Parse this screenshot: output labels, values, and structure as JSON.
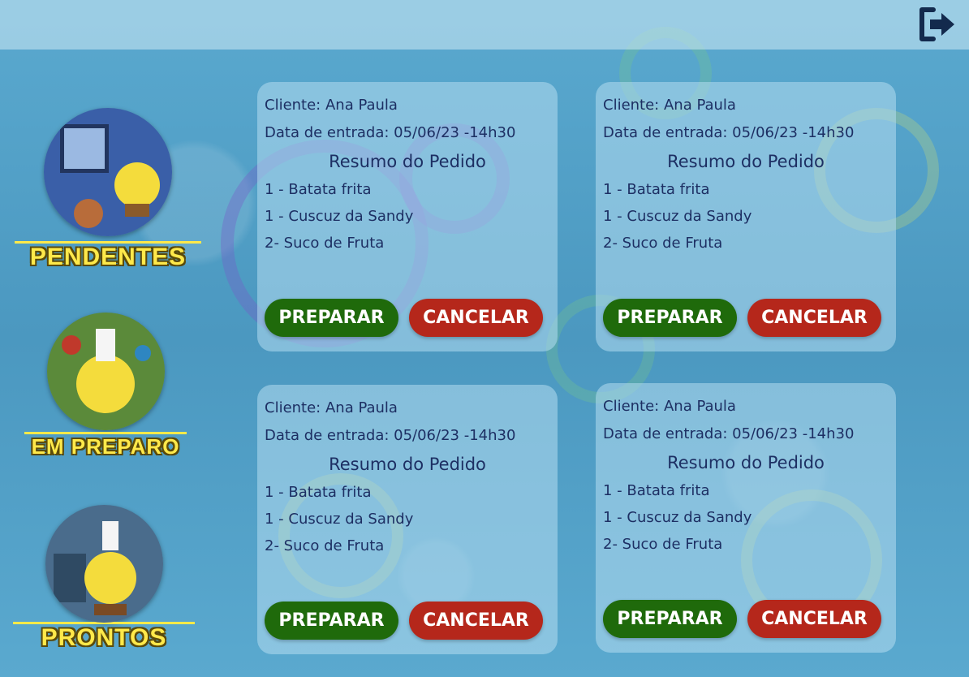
{
  "header": {
    "logout_icon": "logout-icon"
  },
  "sidebar": {
    "items": [
      {
        "label": "PENDENTES",
        "icon": "pendentes-image"
      },
      {
        "label": "EM PREPARO",
        "icon": "em-preparo-image"
      },
      {
        "label": "PRONTOS",
        "icon": "prontos-image"
      }
    ]
  },
  "orders": [
    {
      "client": "Cliente: Ana Paula",
      "date": "Data de entrada: 05/06/23 -14h30",
      "summary_title": "Resumo do Pedido",
      "items": [
        "1 - Batata frita",
        "1 - Cuscuz da Sandy",
        "2- Suco de Fruta"
      ],
      "prepare_label": "PREPARAR",
      "cancel_label": "CANCELAR"
    },
    {
      "client": "Cliente: Ana Paula",
      "date": "Data de entrada: 05/06/23 -14h30",
      "summary_title": "Resumo do Pedido",
      "items": [
        "1 - Batata frita",
        "1 - Cuscuz da Sandy",
        "2- Suco de Fruta"
      ],
      "prepare_label": "PREPARAR",
      "cancel_label": "CANCELAR"
    },
    {
      "client": "Cliente: Ana Paula",
      "date": "Data de entrada: 05/06/23 -14h30",
      "summary_title": "Resumo do Pedido",
      "items": [
        "1 - Batata frita",
        "1 - Cuscuz da Sandy",
        "2- Suco de Fruta"
      ],
      "prepare_label": "PREPARAR",
      "cancel_label": "CANCELAR"
    },
    {
      "client": "Cliente: Ana Paula",
      "date": "Data de entrada: 05/06/23 -14h30",
      "summary_title": "Resumo do Pedido",
      "items": [
        "1 - Batata frita",
        "1 - Cuscuz da Sandy",
        "2- Suco de Fruta"
      ],
      "prepare_label": "PREPARAR",
      "cancel_label": "CANCELAR"
    }
  ],
  "colors": {
    "prepare": "#1f6a0b",
    "cancel": "#b5271b",
    "label_yellow": "#ffe94a",
    "text": "#1d2f63"
  }
}
